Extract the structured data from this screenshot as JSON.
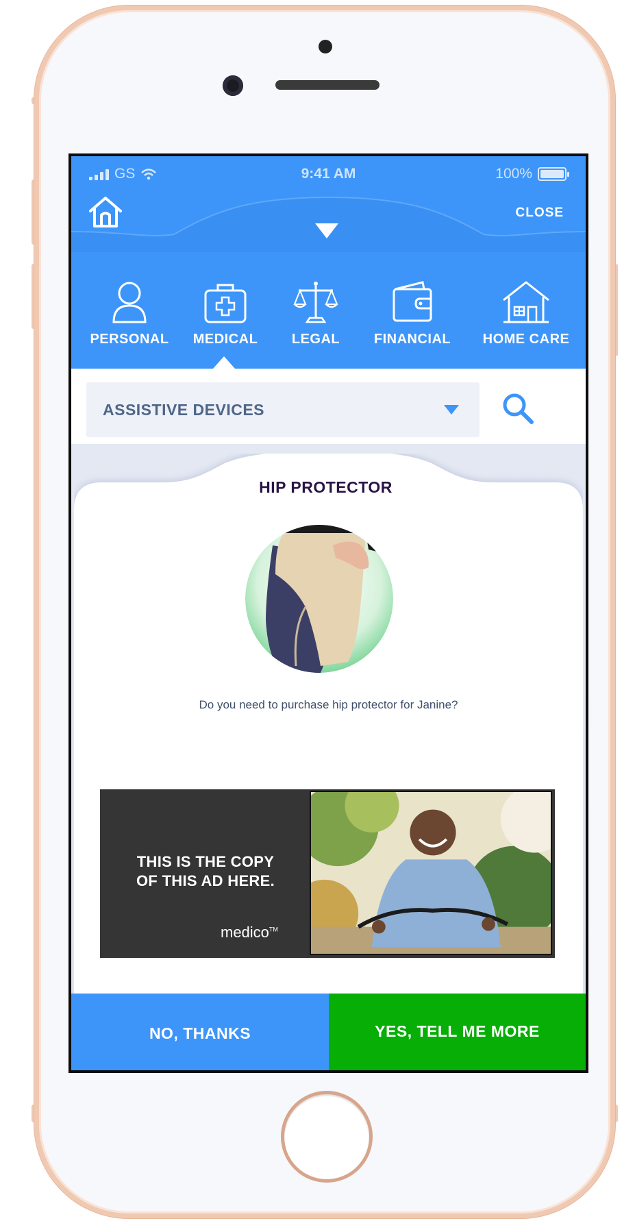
{
  "status_bar": {
    "carrier": "GS",
    "time": "9:41 AM",
    "battery": "100%"
  },
  "header": {
    "close_label": "CLOSE",
    "icons": [
      "home-icon",
      "collapse-arrow-icon"
    ]
  },
  "categories": [
    {
      "label": "PERSONAL",
      "icon": "person-icon"
    },
    {
      "label": "MEDICAL",
      "icon": "medical-kit-icon",
      "active": true
    },
    {
      "label": "LEGAL",
      "icon": "scales-icon"
    },
    {
      "label": "FINANCIAL",
      "icon": "wallet-icon"
    },
    {
      "label": "HOME CARE",
      "icon": "house-icon"
    }
  ],
  "filter": {
    "selected": "ASSISTIVE DEVICES",
    "search_icon": "search-icon"
  },
  "card": {
    "title": "HIP PROTECTOR",
    "question": "Do you need to purchase hip protector for Janine?"
  },
  "ad": {
    "copy_line1": "THIS IS THE COPY",
    "copy_line2": "OF THIS AD HERE.",
    "brand": "medico",
    "brand_mark": "TM"
  },
  "actions": {
    "no_label": "NO, THANKS",
    "yes_label": "YES, TELL ME MORE"
  },
  "colors": {
    "primary_blue": "#3d95f9",
    "accent_green": "#06ae06",
    "title_purple": "#2a1446"
  }
}
